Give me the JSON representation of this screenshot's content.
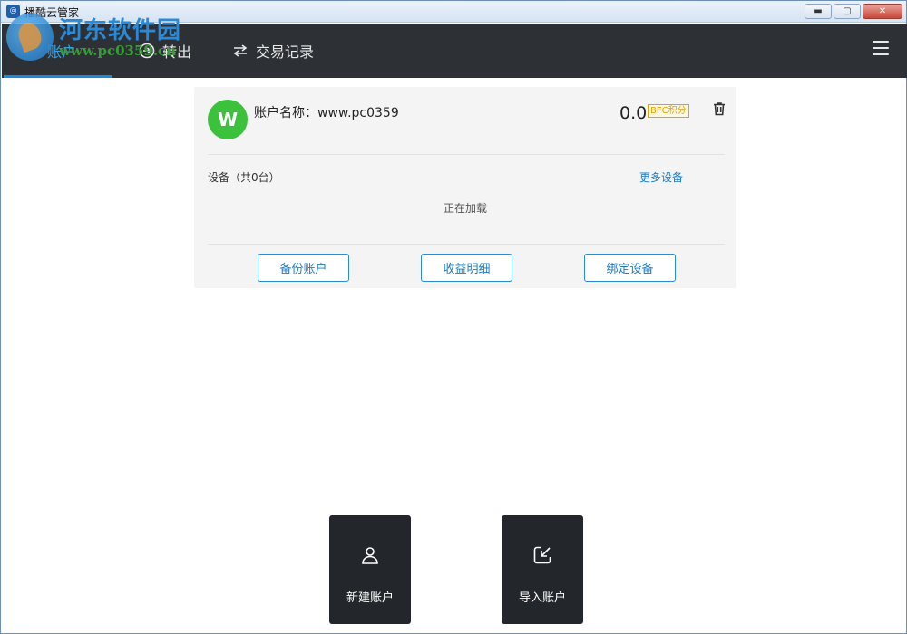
{
  "window": {
    "title": "播酷云管家",
    "app_icon_glyph": "◎",
    "minimize_glyph": "▬",
    "maximize_glyph": "▢",
    "close_glyph": "✕"
  },
  "watermark": {
    "title": "河东软件园",
    "url": "www.pc0359.cn"
  },
  "nav": {
    "tabs": [
      {
        "label": "账户",
        "icon": "account-icon"
      },
      {
        "label": "转出",
        "icon": "transfer-out-icon"
      },
      {
        "label": "交易记录",
        "icon": "exchange-icon"
      }
    ],
    "menu_icon": "hamburger-menu-icon",
    "accent": "#1d88d8"
  },
  "account": {
    "avatar_letter": "W",
    "avatar_color": "#3cc13c",
    "name_text": "账户名称：www.pc0359",
    "balance": "0.0",
    "unit": "BFC积分",
    "devices_label": "设备（共0台）",
    "more_devices": "更多设备",
    "loading_text": "正在加载",
    "buttons": {
      "backup": "备份账户",
      "earnings": "收益明细",
      "bind": "绑定设备"
    }
  },
  "tiles": {
    "new_account": "新建账户",
    "import_account": "导入账户"
  }
}
